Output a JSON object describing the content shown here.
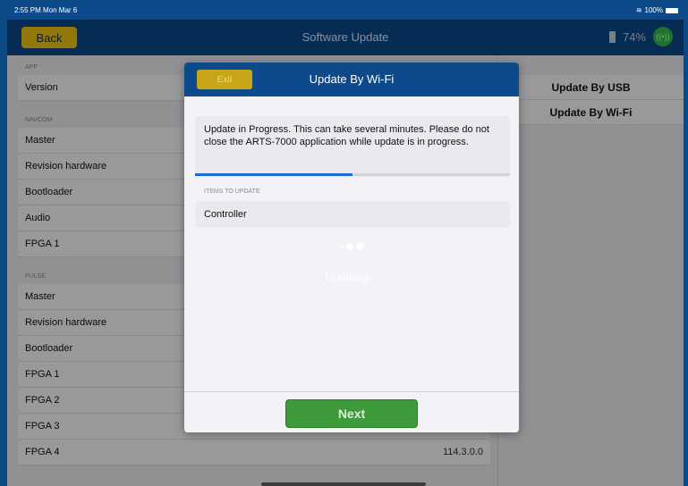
{
  "status_bar": {
    "time": "2:55 PM  Mon Mar 6",
    "battery": "100%"
  },
  "nav": {
    "back_label": "Back",
    "title": "Software Update",
    "battery_level": "74%"
  },
  "left": {
    "sections": [
      {
        "header": "APP",
        "rows": [
          {
            "label": "Version",
            "value": ""
          }
        ]
      },
      {
        "header": "NAVCOM",
        "rows": [
          {
            "label": "Master",
            "value": ""
          },
          {
            "label": "Revision hardware",
            "value": ""
          },
          {
            "label": "Bootloader",
            "value": ""
          },
          {
            "label": "Audio",
            "value": ""
          },
          {
            "label": "FPGA 1",
            "value": ""
          }
        ]
      },
      {
        "header": "PULSE",
        "rows": [
          {
            "label": "Master",
            "value": ""
          },
          {
            "label": "Revision hardware",
            "value": ""
          },
          {
            "label": "Bootloader",
            "value": ""
          },
          {
            "label": "FPGA 1",
            "value": ""
          },
          {
            "label": "FPGA 2",
            "value": ""
          },
          {
            "label": "FPGA 3",
            "value": ""
          },
          {
            "label": "FPGA 4",
            "value": "114.3.0.0"
          }
        ]
      }
    ]
  },
  "right": {
    "header": "IONS",
    "actions": [
      "Update By USB",
      "Update By Wi-Fi"
    ]
  },
  "modal": {
    "exit_label": "Exit",
    "title": "Update By Wi-Fi",
    "message": "Update in Progress. This can take several minutes. Please do not close the ARTS-7000 application while update is in progress.",
    "progress_percent": 50,
    "items_header": "ITEMS TO UPDATE",
    "items": [
      "Controller"
    ],
    "status_text": "Updating...",
    "next_label": "Next"
  },
  "colors": {
    "brand": "#0d4a8c",
    "accent_yellow": "#f3c812",
    "next_green": "#3f9a3c",
    "progress": "#1d6bd0"
  }
}
